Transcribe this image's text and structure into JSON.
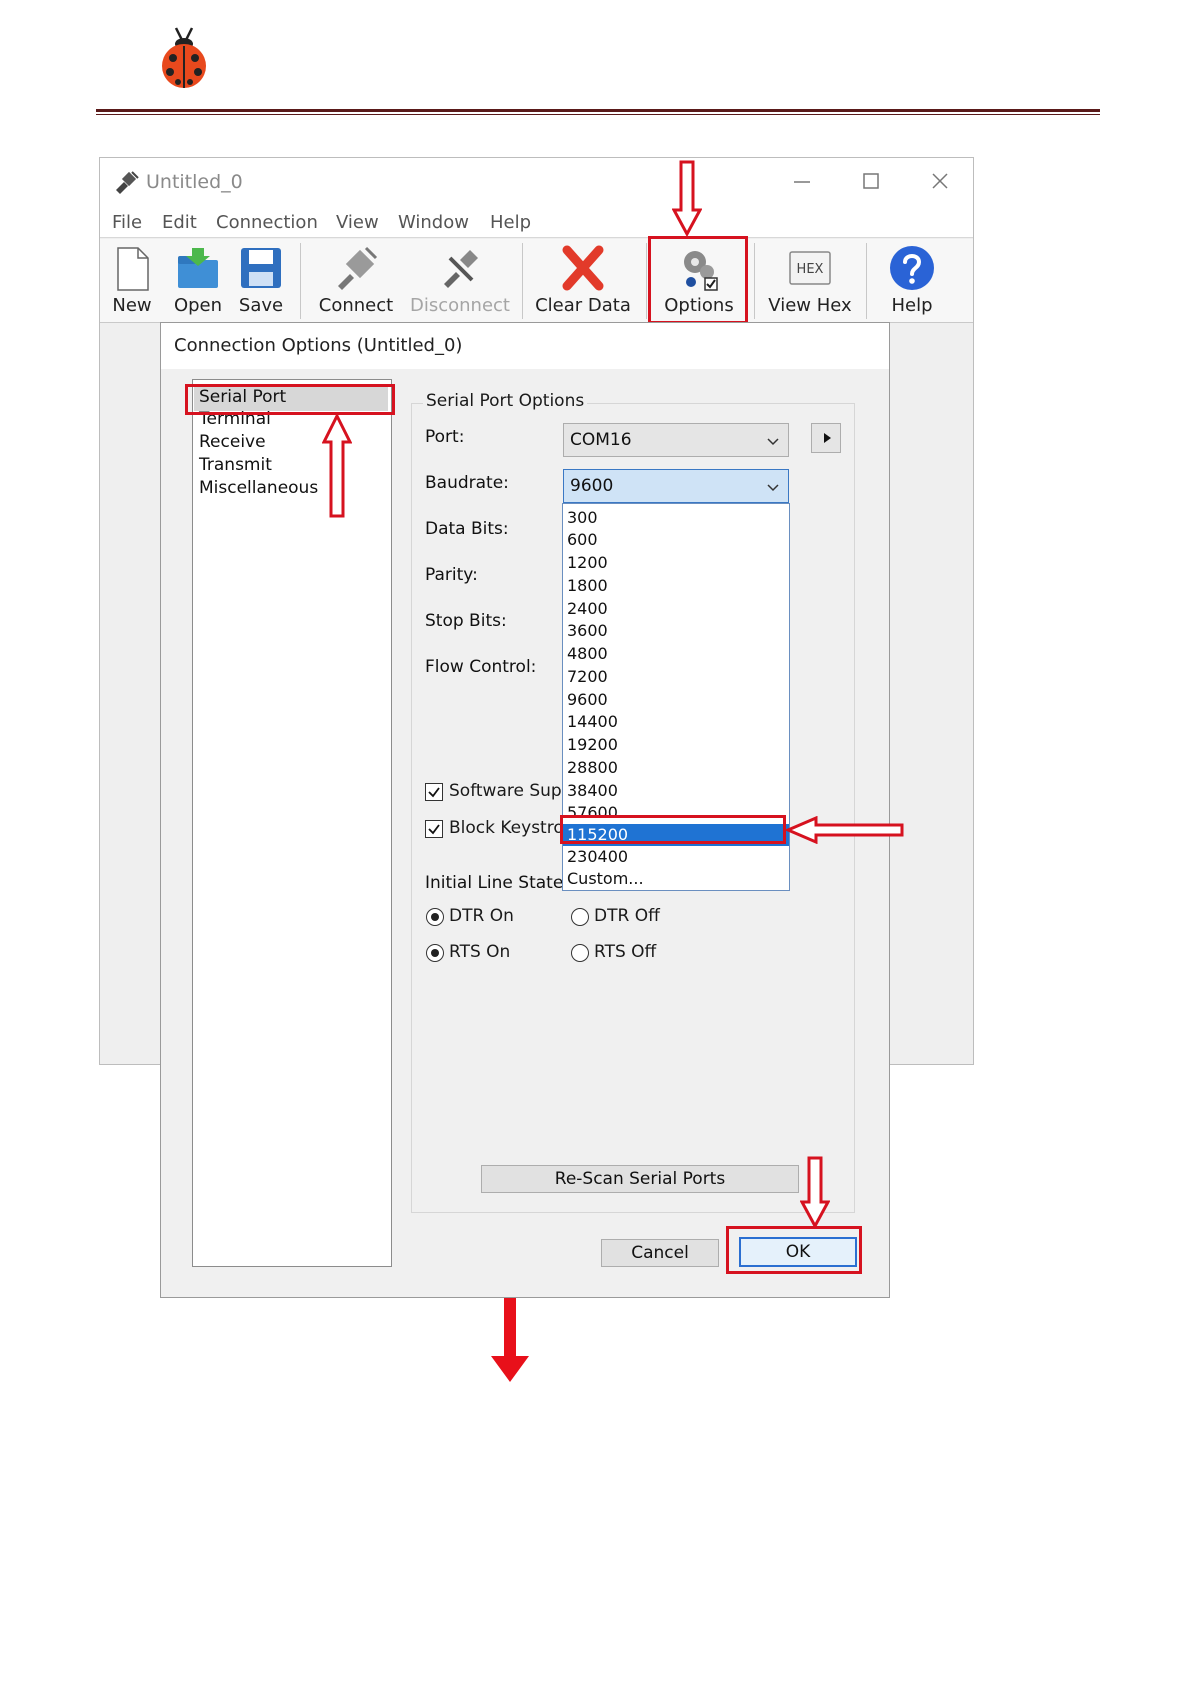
{
  "colors": {
    "annotation": "#d6121f",
    "selection": "#1f73d3",
    "header_rule": "#5a1a1a"
  },
  "header": {
    "logo": "ladybug-logo"
  },
  "app": {
    "title": "Untitled_0",
    "menu": [
      "File",
      "Edit",
      "Connection",
      "View",
      "Window",
      "Help"
    ],
    "toolbar": {
      "new": "New",
      "open": "Open",
      "save": "Save",
      "connect": "Connect",
      "disconnect": "Disconnect",
      "clear": "Clear Data",
      "options": "Options",
      "view_hex": "View Hex",
      "help": "Help",
      "hex_icon_text": "HEX"
    }
  },
  "dialog": {
    "title": "Connection Options (Untitled_0)",
    "categories": [
      "Serial Port",
      "Terminal",
      "Receive",
      "Transmit",
      "Miscellaneous"
    ],
    "selected_category": "Serial Port",
    "group_title": "Serial Port Options",
    "labels": {
      "port": "Port:",
      "baudrate": "Baudrate:",
      "data_bits": "Data Bits:",
      "parity": "Parity:",
      "stop_bits": "Stop Bits:",
      "flow_control": "Flow Control:",
      "initial_line_states": "Initial Line States"
    },
    "port_value": "COM16",
    "baud_value": "9600",
    "baud_options": [
      "300",
      "600",
      "1200",
      "1800",
      "2400",
      "3600",
      "4800",
      "7200",
      "9600",
      "14400",
      "19200",
      "28800",
      "38400",
      "57600",
      "115200",
      "230400",
      "Custom..."
    ],
    "baud_highlighted": "115200",
    "checkboxes": {
      "software_supply": "Software Supp",
      "block_keystrokes": "Block Keystro"
    },
    "radios": {
      "dtr_on": "DTR On",
      "dtr_off": "DTR Off",
      "rts_on": "RTS On",
      "rts_off": "RTS Off"
    },
    "buttons": {
      "rescan": "Re-Scan Serial Ports",
      "cancel": "Cancel",
      "ok": "OK"
    }
  }
}
